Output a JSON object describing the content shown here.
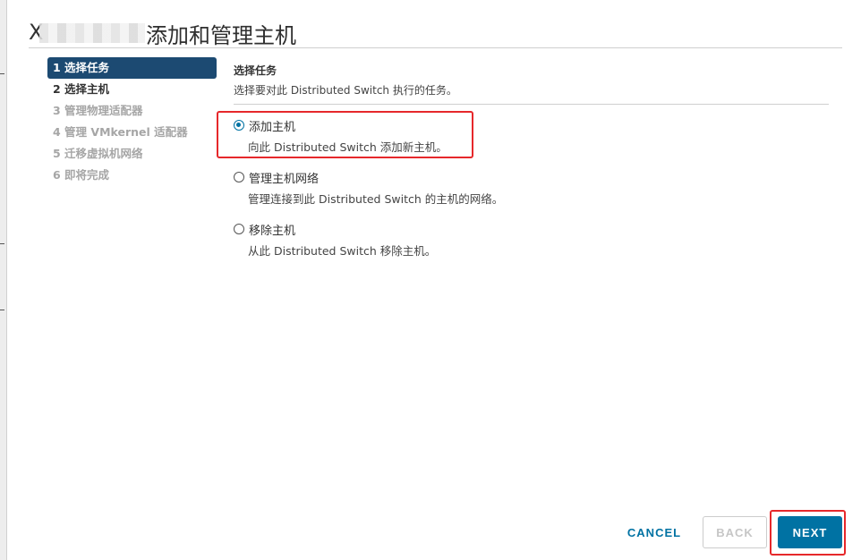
{
  "dialog": {
    "title_prefix": "X",
    "title": "添加和管理主机"
  },
  "steps": [
    {
      "label": "1 选择任务",
      "state": "active"
    },
    {
      "label": "2 选择主机",
      "state": "current"
    },
    {
      "label": "3 管理物理适配器",
      "state": "disabled"
    },
    {
      "label": "4 管理 VMkernel 适配器",
      "state": "disabled"
    },
    {
      "label": "5 迁移虚拟机网络",
      "state": "disabled"
    },
    {
      "label": "6 即将完成",
      "state": "disabled"
    }
  ],
  "section": {
    "title": "选择任务",
    "description": "选择要对此 Distributed Switch 执行的任务。"
  },
  "options": [
    {
      "label": "添加主机",
      "description": "向此 Distributed Switch 添加新主机。",
      "checked": true
    },
    {
      "label": "管理主机网络",
      "description": "管理连接到此 Distributed Switch 的主机的网络。",
      "checked": false
    },
    {
      "label": "移除主机",
      "description": "从此 Distributed Switch 移除主机。",
      "checked": false
    }
  ],
  "buttons": {
    "cancel": "CANCEL",
    "back": "BACK",
    "next": "NEXT"
  },
  "colors": {
    "accent": "#0072a3",
    "active_step_bg": "#1c4a72",
    "highlight": "#e6282b"
  }
}
